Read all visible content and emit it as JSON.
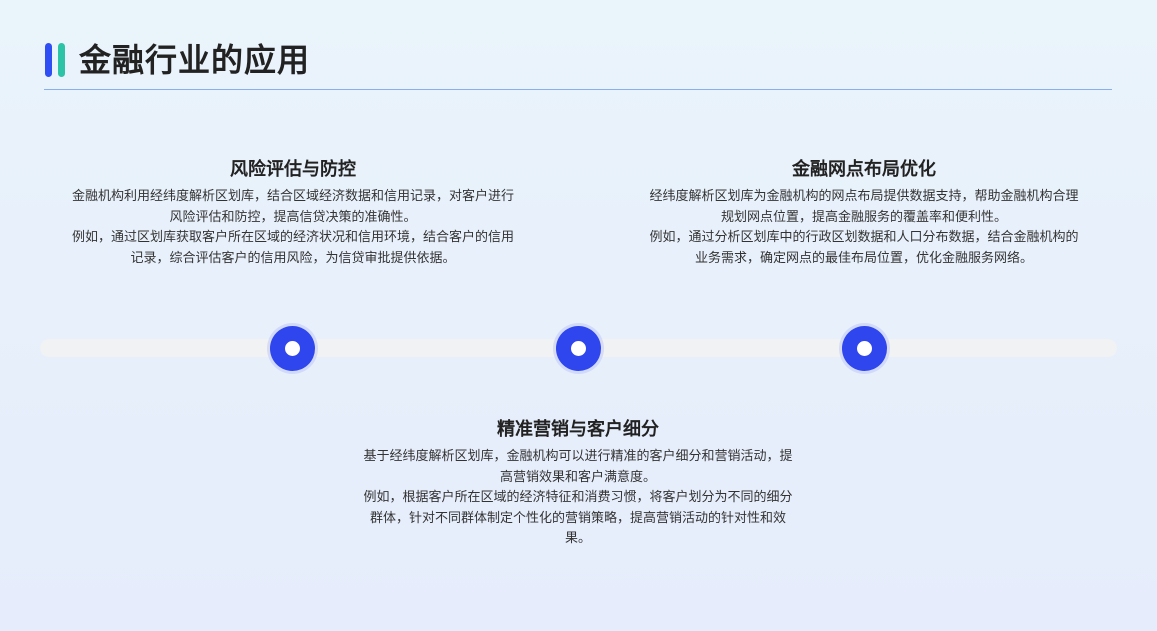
{
  "header": {
    "title": "金融行业的应用",
    "accent_colors": [
      "#2f4ff5",
      "#2cc3a6"
    ]
  },
  "timeline": {
    "node_color": "#2f45ee",
    "track_color": "#f0f2f4"
  },
  "sections": [
    {
      "title": "风险评估与防控",
      "paragraphs": [
        "金融机构利用经纬度解析区划库，结合区域经济数据和信用记录，对客户进行风险评估和防控，提高信贷决策的准确性。",
        "例如，通过区划库获取客户所在区域的经济状况和信用环境，结合客户的信用记录，综合评估客户的信用风险，为信贷审批提供依据。"
      ]
    },
    {
      "title": "金融网点布局优化",
      "paragraphs": [
        "经纬度解析区划库为金融机构的网点布局提供数据支持，帮助金融机构合理规划网点位置，提高金融服务的覆盖率和便利性。",
        "例如，通过分析区划库中的行政区划数据和人口分布数据，结合金融机构的业务需求，确定网点的最佳布局位置，优化金融服务网络。"
      ]
    },
    {
      "title": "精准营销与客户细分",
      "paragraphs": [
        "基于经纬度解析区划库，金融机构可以进行精准的客户细分和营销活动，提高营销效果和客户满意度。",
        "例如，根据客户所在区域的经济特征和消费习惯，将客户划分为不同的细分群体，针对不同群体制定个性化的营销策略，提高营销活动的针对性和效果。"
      ]
    }
  ]
}
